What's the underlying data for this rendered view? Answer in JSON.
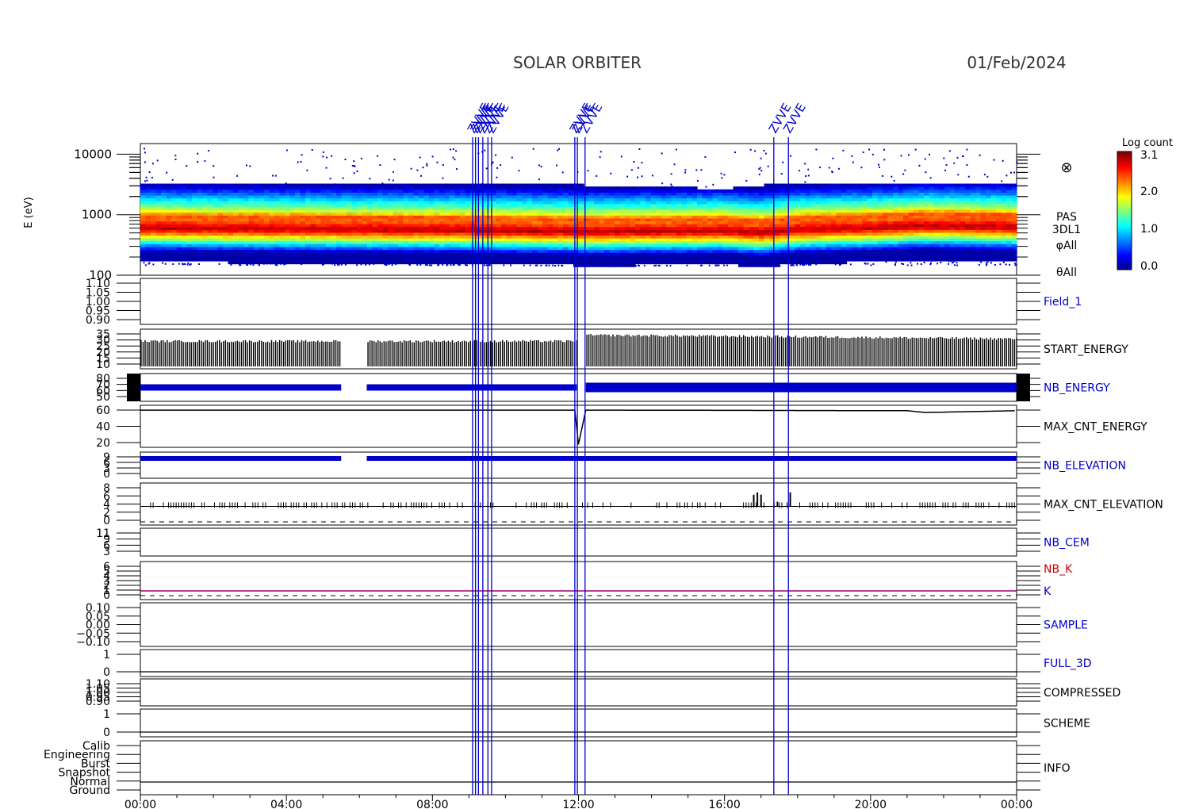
{
  "header": {
    "title": "SOLAR ORBITER",
    "date": "01/Feb/2024"
  },
  "colorbar": {
    "title": "Log count",
    "ticks": [
      "3.1",
      "2.0",
      "1.0",
      "0.0"
    ]
  },
  "time_axis": {
    "ticks": [
      "00:00",
      "04:00",
      "08:00",
      "12:00",
      "16:00",
      "20:00",
      "00:00"
    ]
  },
  "spectrogram": {
    "ylabel": "E (eV)",
    "yticks": [
      "10000",
      "1000",
      "100"
    ],
    "right_labels": [
      "PAS",
      "3DL1",
      "φAll",
      "θAll"
    ],
    "symbol": "⊗"
  },
  "panels": [
    {
      "id": "field1",
      "label": "Field_1",
      "label_color": "#0000cc",
      "ticks": [
        "1.10",
        "1.05",
        "1.00",
        "0.95",
        "0.90"
      ]
    },
    {
      "id": "start-energy",
      "label": "START_ENERGY",
      "label_color": "#000000",
      "ticks": [
        "35",
        "30",
        "25",
        "20",
        "15",
        "10"
      ]
    },
    {
      "id": "nb-energy",
      "label": "NB_ENERGY",
      "label_color": "#0000cc",
      "ticks": [
        "80",
        "70",
        "60",
        "50"
      ]
    },
    {
      "id": "max-cnt-energy",
      "label": "MAX_CNT_ENERGY",
      "label_color": "#000000",
      "ticks": [
        "60",
        "40",
        "20"
      ]
    },
    {
      "id": "nb-elevation",
      "label": "NB_ELEVATION",
      "label_color": "#0000cc",
      "ticks": [
        "9",
        "6",
        "3",
        "0"
      ]
    },
    {
      "id": "max-cnt-elevation",
      "label": "MAX_CNT_ELEVATION",
      "label_color": "#000000",
      "ticks": [
        "8",
        "6",
        "4",
        "2",
        "0"
      ]
    },
    {
      "id": "nb-cem",
      "label": "NB_CEM",
      "label_color": "#0000cc",
      "ticks": [
        "11",
        "9",
        "6",
        "3"
      ]
    },
    {
      "id": "nb-k",
      "label": "NB_K",
      "label_color": "#cc0000",
      "label2": "K",
      "label2_color": "#0000cc",
      "ticks": [
        "6",
        "5",
        "4",
        "3",
        "2",
        "1",
        "0"
      ]
    },
    {
      "id": "sample",
      "label": "SAMPLE",
      "label_color": "#0000cc",
      "ticks": [
        "0.10",
        "0.05",
        "0.00",
        "−0.05",
        "−0.10"
      ]
    },
    {
      "id": "full-3d",
      "label": "FULL_3D",
      "label_color": "#0000cc",
      "ticks": [
        "1",
        "0"
      ]
    },
    {
      "id": "compressed",
      "label": "COMPRESSED",
      "label_color": "#000000",
      "ticks": [
        "1.10",
        "1.05",
        "1.00",
        "0.95",
        "0.90"
      ]
    },
    {
      "id": "scheme",
      "label": "SCHEME",
      "label_color": "#000000",
      "ticks": [
        "1",
        "0"
      ]
    },
    {
      "id": "info",
      "label": "INFO",
      "label_color": "#000000",
      "ticks": [
        "Calib",
        "Engineering",
        "Burst",
        "Snapshot",
        "Normal",
        "Ground"
      ]
    }
  ],
  "events": {
    "color": "#0000cc",
    "times_h": [
      9.1,
      9.18,
      9.26,
      9.38,
      9.52,
      9.62,
      11.9,
      11.97,
      12.18,
      17.35,
      17.75
    ],
    "labels": [
      "ZVVE",
      "ZVVE",
      "ZVVE",
      "ZVVE",
      "ZVVE",
      "ZVVE",
      "ZVVE",
      "ZVVE",
      "ZVVE",
      "ZVVE",
      "ZVVE"
    ]
  },
  "chart_data": {
    "type": "heatmap",
    "title": "SOLAR ORBITER",
    "date": "01/Feb/2024",
    "x_range_h": [
      0,
      24
    ],
    "spectrogram": {
      "ylabel": "E (eV)",
      "y_scale": "log",
      "ylim": [
        100,
        15000
      ],
      "color_scale_label": "Log count",
      "color_range": [
        0.0,
        3.1
      ],
      "band_peak_energy_ev": {
        "times_h": [
          0,
          4,
          8,
          11.7,
          12.2,
          16,
          17,
          18,
          20,
          21.5,
          24
        ],
        "values": [
          600,
          580,
          560,
          530,
          520,
          540,
          500,
          560,
          600,
          650,
          620
        ]
      },
      "upper_envelope_ev": {
        "times_h": [
          0,
          12,
          16,
          18,
          20,
          24
        ],
        "values": [
          3300,
          3100,
          2700,
          3400,
          3300,
          3100
        ]
      }
    },
    "series": [
      {
        "name": "START_ENERGY",
        "times_h": [
          0,
          5.5,
          6.2,
          11.9,
          12.2,
          17,
          24
        ],
        "values": [
          28,
          28,
          28,
          28,
          33,
          32,
          30
        ],
        "gaps_h": [
          [
            5.5,
            6.2
          ],
          [
            12.0,
            12.2
          ]
        ]
      },
      {
        "name": "NB_ENERGY",
        "times_h": [
          0,
          24
        ],
        "values": [
          64,
          64
        ]
      },
      {
        "name": "MAX_CNT_ENERGY",
        "times_h": [
          0,
          11.9,
          12.0,
          12.2,
          21,
          21.5,
          24
        ],
        "values": [
          62,
          62,
          5,
          62,
          61,
          58,
          61
        ]
      },
      {
        "name": "NB_ELEVATION",
        "times_h": [
          0,
          24
        ],
        "values": [
          8,
          8
        ]
      },
      {
        "name": "MAX_CNT_ELEVATION",
        "times_h": [
          0,
          16.8,
          16.9,
          17.0,
          17.4,
          17.8,
          24
        ],
        "values": [
          4,
          4,
          6,
          4,
          5,
          6,
          4
        ]
      },
      {
        "name": "NB_K",
        "times_h": [
          0,
          24
        ],
        "values": [
          1,
          1
        ]
      },
      {
        "name": "K",
        "times_h": [
          0,
          24
        ],
        "values": [
          0,
          0
        ]
      },
      {
        "name": "FULL_3D",
        "times_h": [
          0,
          24
        ],
        "values": [
          0,
          0
        ]
      },
      {
        "name": "SCHEME",
        "times_h": [
          0,
          24
        ],
        "values": [
          0,
          0
        ]
      },
      {
        "name": "INFO",
        "times_h": [
          0,
          24
        ],
        "values": [
          "Normal",
          "Normal"
        ]
      }
    ]
  }
}
